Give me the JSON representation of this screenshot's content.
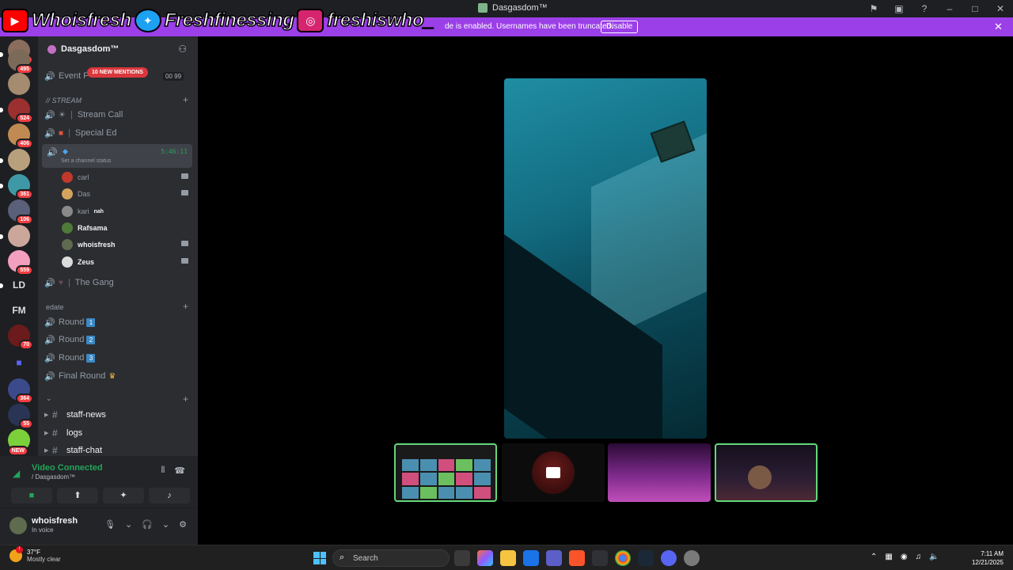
{
  "titlebar": {
    "title": "Dasgasdom™",
    "icons": [
      "flag-icon",
      "monitor-icon",
      "help-icon",
      "minimize-icon",
      "maximize-icon",
      "close-icon"
    ]
  },
  "banner": {
    "message": "de is enabled. Usernames have been truncated.",
    "disable_label": "Disable",
    "close_glyph": "✕",
    "color": "#9b3fe8"
  },
  "overlay": {
    "youtube": "Whoisfresh",
    "twitter": "Freshfinessing",
    "instagram": "freshiswho_"
  },
  "rail": {
    "servers": [
      {
        "badge": "10"
      },
      {
        "badge": "495"
      },
      {
        "badge": ""
      },
      {
        "badge": "524"
      },
      {
        "badge": "406"
      },
      {
        "badge": ""
      },
      {
        "badge": "361"
      },
      {
        "badge": "106"
      },
      {
        "badge": ""
      },
      {
        "badge": "559"
      }
    ],
    "text_servers": [
      "LD",
      "FM"
    ],
    "lower_badges": [
      "70",
      "364",
      "55"
    ],
    "new_label": "NEW"
  },
  "server": {
    "name": "Dasgasdom™",
    "mentions": "10 NEW MENTIONS",
    "event_label": "Event F",
    "event_count": "00 99"
  },
  "categories": {
    "stream": "// STREAM",
    "edate": "edate",
    "blank": "⌄"
  },
  "channels": {
    "stream_call": "Stream Call",
    "special_ed": "Special Ed",
    "active_timer": "5:46:11",
    "active_status": "Set a channel status",
    "the_gang": "The Gang",
    "round1": "Round",
    "round2": "Round",
    "round3": "Round",
    "final_round": "Final Round",
    "round_nums": [
      "1",
      "2",
      "3"
    ]
  },
  "members": [
    {
      "name": "carl",
      "cam": true,
      "live": false,
      "color": "#c0392b"
    },
    {
      "name": "Das",
      "cam": true,
      "live": false,
      "color": "#d4a45f"
    },
    {
      "name": "kari",
      "cam": false,
      "live": false,
      "tag": "nah",
      "color": "#8a8a8a"
    },
    {
      "name": "Rafsama",
      "cam": false,
      "live": true,
      "color": "#4f7a3a"
    },
    {
      "name": "whoisfresh",
      "cam": true,
      "live": true,
      "color": "#5e6b4f"
    },
    {
      "name": "Zeus",
      "cam": true,
      "live": true,
      "color": "#dcdcdc"
    }
  ],
  "text_channels": [
    "staff-news",
    "logs",
    "staff-chat"
  ],
  "voice": {
    "title": "Video Connected",
    "subtitle": "/ Dasgasdom™"
  },
  "user": {
    "name": "whoisfresh",
    "status": "In voice"
  },
  "taskbar": {
    "temp": "37°F",
    "condition": "Mostly clear",
    "search_placeholder": "Search",
    "time": "7:11 AM",
    "date": "12/21/2025"
  }
}
